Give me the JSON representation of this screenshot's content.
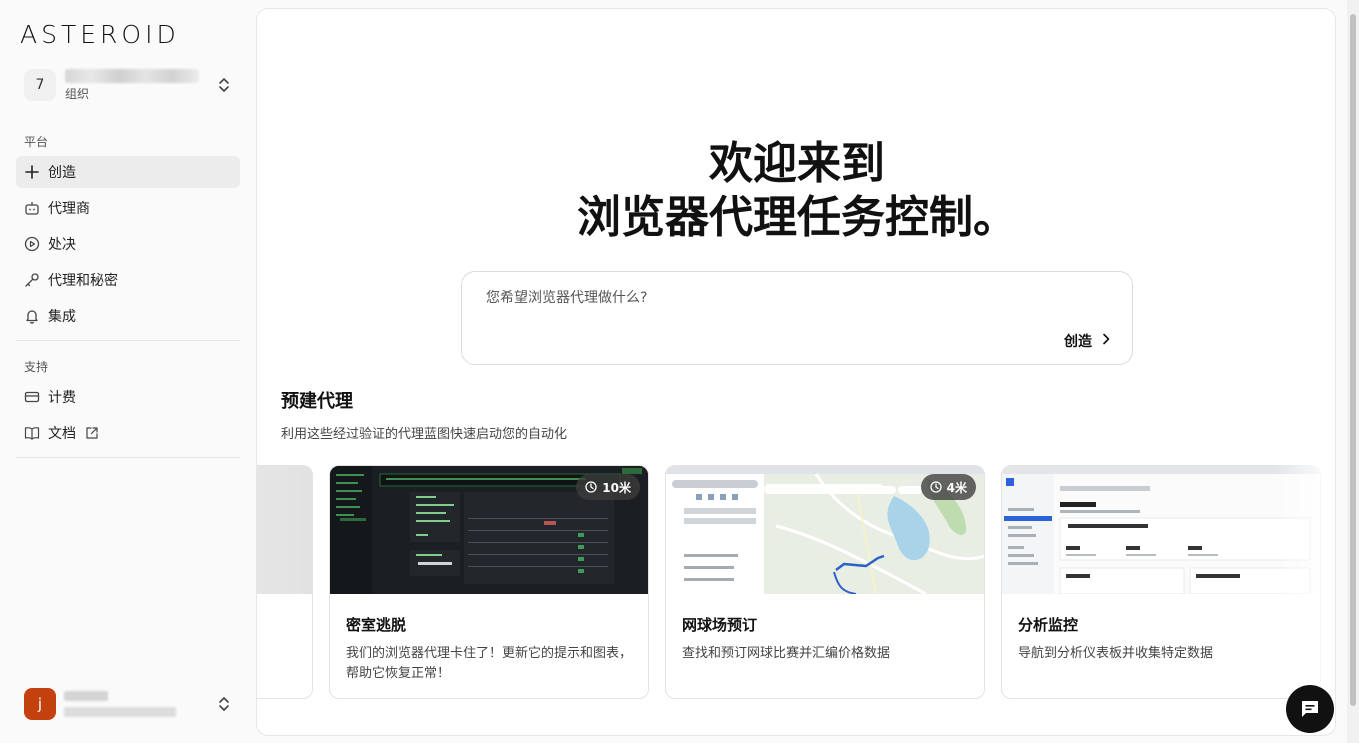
{
  "app": {
    "logo": "ASTEROID"
  },
  "org": {
    "avatar_letter": "7",
    "subtitle": "组织"
  },
  "sidebar": {
    "platform_label": "平台",
    "platform_items": [
      {
        "label": "创造",
        "icon": "plus-icon"
      },
      {
        "label": "代理商",
        "icon": "robot-icon"
      },
      {
        "label": "处决",
        "icon": "play-circle-icon"
      },
      {
        "label": "代理和秘密",
        "icon": "key-icon"
      },
      {
        "label": "集成",
        "icon": "bell-icon"
      }
    ],
    "support_label": "支持",
    "support_items": [
      {
        "label": "计费",
        "icon": "credit-card-icon"
      },
      {
        "label": "文档",
        "icon": "book-icon"
      }
    ]
  },
  "user": {
    "avatar_letter": "j",
    "avatar_color": "#c2410c"
  },
  "hero": {
    "line1": "欢迎来到",
    "line2": "浏览器代理任务控制。"
  },
  "prompt": {
    "placeholder": "您希望浏览器代理做什么?",
    "submit_label": "创造"
  },
  "prebuilt": {
    "title": "预建代理",
    "subtitle": "利用这些经过验证的代理蓝图快速启动您的自动化",
    "cards": [
      {
        "title": "密室逃脱",
        "desc": "我们的浏览器代理卡住了！更新它的提示和图表，帮助它恢复正常！",
        "badge": "10米"
      },
      {
        "title": "网球场预订",
        "desc": "查找和预订网球比赛并汇编价格数据",
        "badge": "4米"
      },
      {
        "title": "分析监控",
        "desc": "导航到分析仪表板并收集特定数据",
        "badge": ""
      }
    ]
  }
}
